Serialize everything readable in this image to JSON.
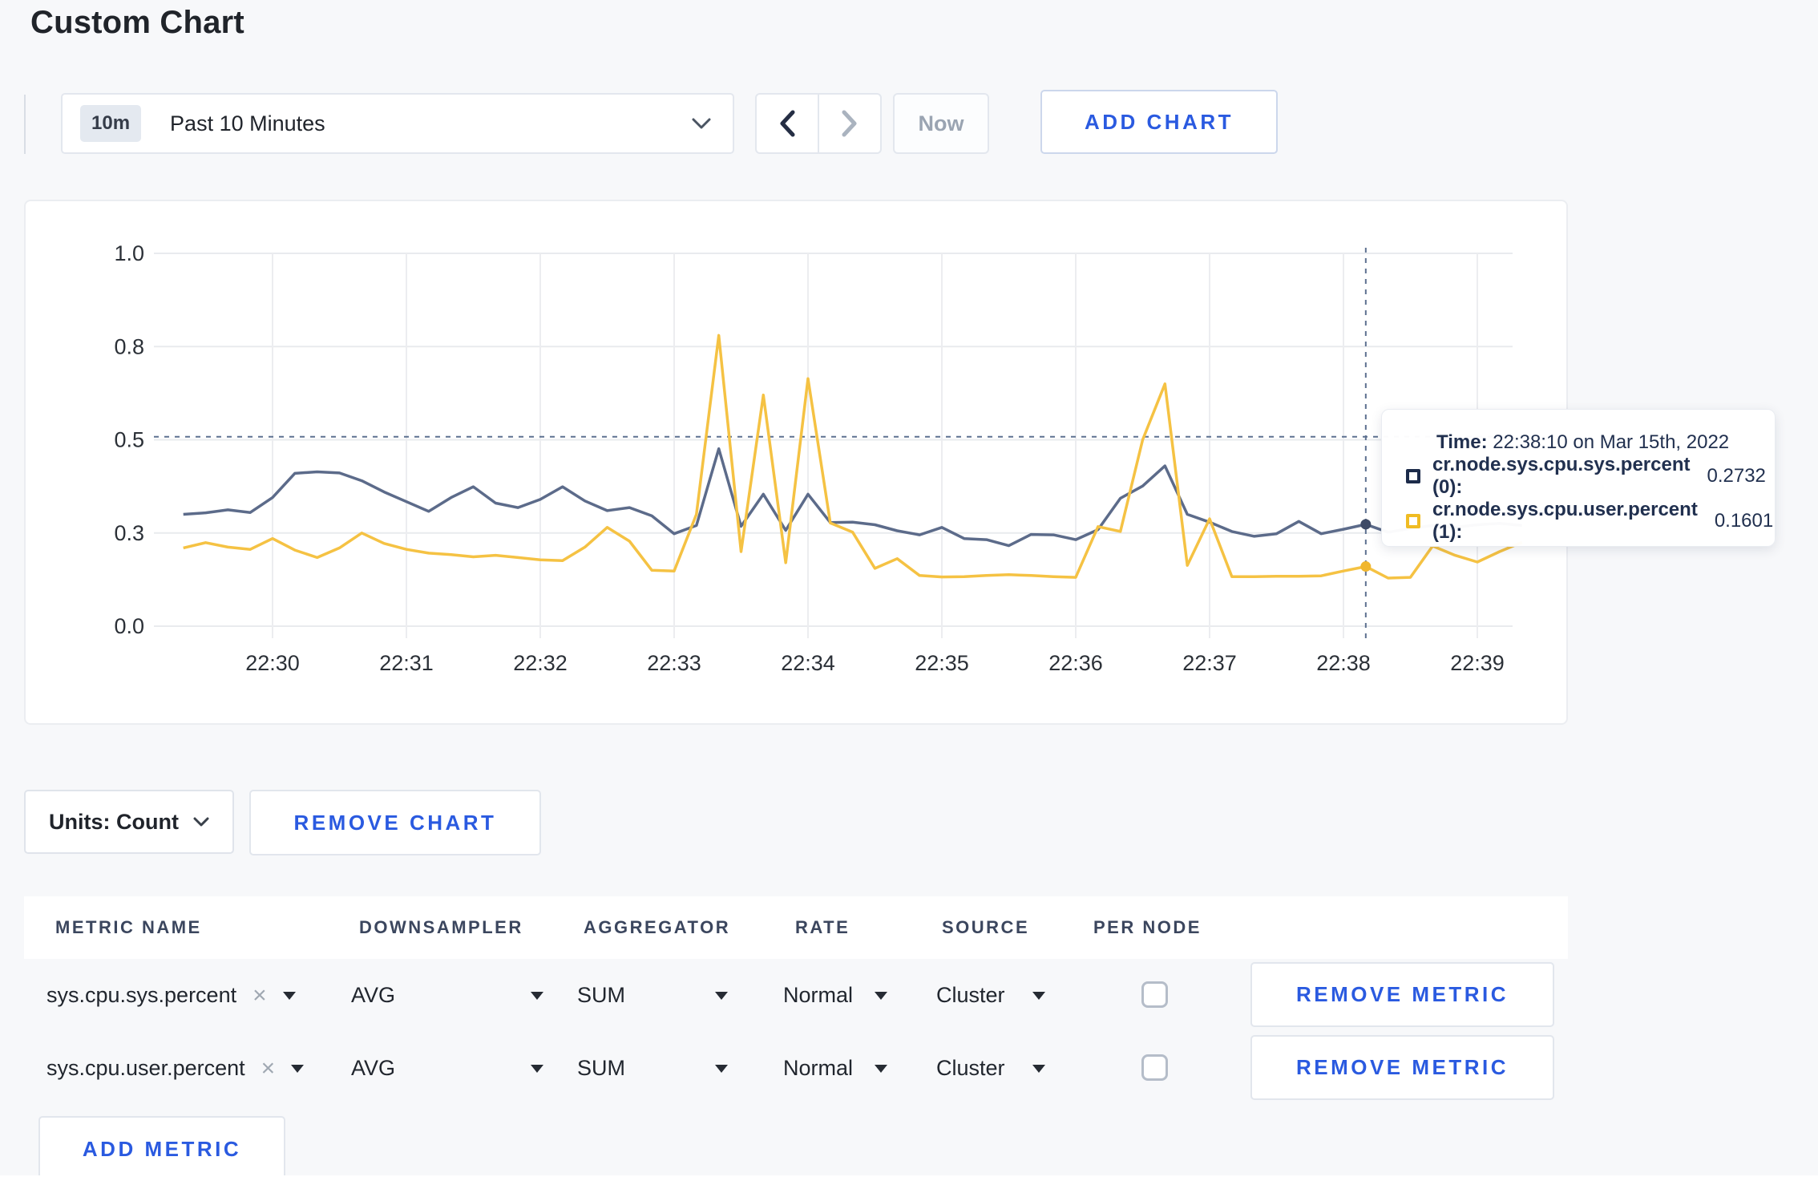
{
  "page": {
    "title": "Custom Chart"
  },
  "toolbar": {
    "timeframe_badge": "10m",
    "timeframe_label": "Past 10 Minutes",
    "now_label": "Now",
    "add_chart_label": "ADD CHART"
  },
  "chart_data": {
    "type": "line",
    "title": "",
    "xlabel": "",
    "ylabel": "",
    "ylim": [
      0,
      1.0
    ],
    "grid": true,
    "legend_position": "tooltip-only",
    "x_ticks": [
      "22:30",
      "22:31",
      "22:32",
      "22:33",
      "22:34",
      "22:35",
      "22:36",
      "22:37",
      "22:38",
      "22:39"
    ],
    "y_ticks": {
      "values": [
        0,
        0.25,
        0.5,
        0.75,
        1.0
      ],
      "labels": [
        "0.0",
        "0.3",
        "0.5",
        "0.8",
        "1.0"
      ]
    },
    "x_start": "22:29:20",
    "x_step_seconds": 10,
    "series": [
      {
        "name": "cr.node.sys.cpu.sys.percent (0)",
        "color": "#5c6b8a",
        "dot_color": "#3e4a66",
        "values": [
          0.3,
          0.304,
          0.312,
          0.305,
          0.345,
          0.41,
          0.414,
          0.411,
          0.39,
          0.36,
          0.334,
          0.308,
          0.345,
          0.374,
          0.33,
          0.318,
          0.34,
          0.374,
          0.336,
          0.31,
          0.318,
          0.296,
          0.248,
          0.27,
          0.476,
          0.268,
          0.354,
          0.257,
          0.354,
          0.278,
          0.279,
          0.272,
          0.256,
          0.245,
          0.265,
          0.235,
          0.232,
          0.216,
          0.246,
          0.245,
          0.232,
          0.259,
          0.343,
          0.376,
          0.43,
          0.3,
          0.279,
          0.254,
          0.241,
          0.248,
          0.281,
          0.248,
          0.26,
          0.2732,
          0.252,
          0.262,
          0.27,
          0.265,
          0.272,
          0.276,
          0.27
        ]
      },
      {
        "name": "cr.node.sys.cpu.user.percent (1)",
        "color": "#f5c243",
        "dot_color": "#f0b62f",
        "values": [
          0.21,
          0.224,
          0.212,
          0.206,
          0.235,
          0.204,
          0.184,
          0.21,
          0.25,
          0.222,
          0.206,
          0.196,
          0.192,
          0.186,
          0.19,
          0.184,
          0.178,
          0.176,
          0.212,
          0.265,
          0.228,
          0.15,
          0.148,
          0.3,
          0.78,
          0.2,
          0.62,
          0.17,
          0.664,
          0.277,
          0.252,
          0.155,
          0.181,
          0.136,
          0.132,
          0.133,
          0.136,
          0.138,
          0.136,
          0.133,
          0.131,
          0.267,
          0.254,
          0.5,
          0.65,
          0.163,
          0.288,
          0.133,
          0.133,
          0.134,
          0.134,
          0.135,
          0.148,
          0.1601,
          0.129,
          0.131,
          0.215,
          0.19,
          0.172,
          0.2,
          0.225
        ]
      }
    ],
    "crosshair": {
      "time": "22:38:10",
      "y_value": 0.508
    }
  },
  "tooltip": {
    "time_label": "Time:",
    "time_value": "22:38:10 on Mar 15th, 2022",
    "rows": [
      {
        "label": "cr.node.sys.cpu.sys.percent (0):",
        "value": "0.2732",
        "color": "#1c2b4a"
      },
      {
        "label": "cr.node.sys.cpu.user.percent (1):",
        "value": "0.1601",
        "color": "#f0bc23"
      }
    ]
  },
  "chart_footer": {
    "units_label": "Units: Count",
    "remove_chart_label": "REMOVE CHART"
  },
  "metrics_table": {
    "headers": [
      "METRIC NAME",
      "DOWNSAMPLER",
      "AGGREGATOR",
      "RATE",
      "SOURCE",
      "PER NODE"
    ],
    "rows": [
      {
        "metric": "sys.cpu.sys.percent",
        "clear": "×",
        "downsampler": "AVG",
        "aggregator": "SUM",
        "rate": "Normal",
        "source": "Cluster",
        "per_node_checked": false,
        "remove_label": "REMOVE METRIC"
      },
      {
        "metric": "sys.cpu.user.percent",
        "clear": "×",
        "downsampler": "AVG",
        "aggregator": "SUM",
        "rate": "Normal",
        "source": "Cluster",
        "per_node_checked": false,
        "remove_label": "REMOVE METRIC"
      }
    ],
    "add_metric_label": "ADD METRIC"
  }
}
